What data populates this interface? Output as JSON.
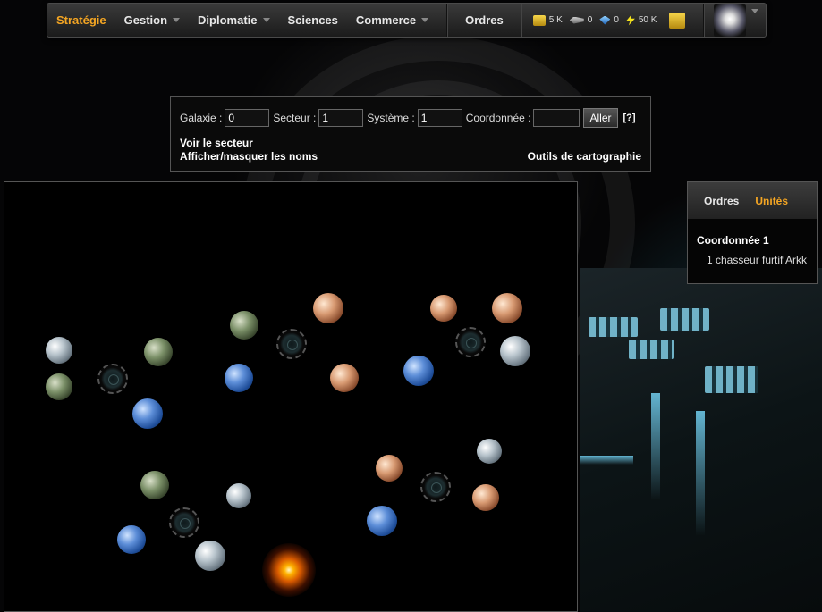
{
  "nav": {
    "items": [
      {
        "label": "Stratégie",
        "active": true,
        "dropdown": false
      },
      {
        "label": "Gestion",
        "active": false,
        "dropdown": true
      },
      {
        "label": "Diplomatie",
        "active": false,
        "dropdown": true
      },
      {
        "label": "Sciences",
        "active": false,
        "dropdown": false
      },
      {
        "label": "Commerce",
        "active": false,
        "dropdown": true
      }
    ],
    "orders_label": "Ordres",
    "resources": [
      {
        "icon": "credits-icon",
        "value": "5 K"
      },
      {
        "icon": "ship-icon",
        "value": "0"
      },
      {
        "icon": "crystal-icon",
        "value": "0"
      },
      {
        "icon": "energy-icon",
        "value": "50 K"
      }
    ],
    "accent": "#f5a623"
  },
  "coordinates": {
    "galaxy_label": "Galaxie :",
    "galaxy_value": "0",
    "sector_label": "Secteur :",
    "sector_value": "1",
    "system_label": "Système :",
    "system_value": "1",
    "coord_label": "Coordonnée :",
    "coord_value": "",
    "go_label": "Aller",
    "help_label": "[?]",
    "view_sector": "Voir le secteur",
    "toggle_names": "Afficher/masquer les noms",
    "mapping_tools": "Outils de cartographie"
  },
  "side_panel": {
    "tabs": [
      {
        "label": "Ordres",
        "active": false
      },
      {
        "label": "Unités",
        "active": true
      }
    ],
    "title": "Coordonnée 1",
    "unit": "1 chasseur furtif Arkk"
  }
}
